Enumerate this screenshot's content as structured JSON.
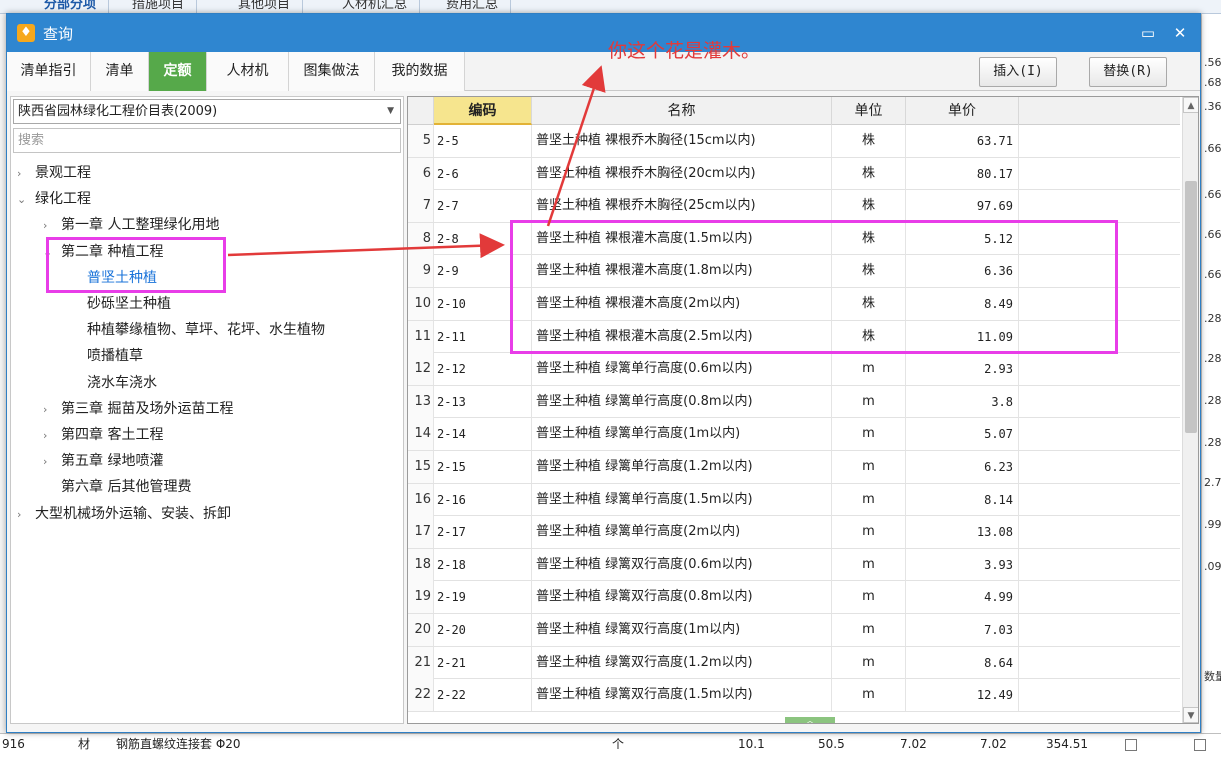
{
  "background": {
    "top_tabs": [
      "分部分项",
      "措施项目",
      "其他项目",
      "人材机汇总",
      "费用汇总"
    ],
    "right_numbers": [
      ".56",
      ".68",
      ".36",
      ".66",
      ".66",
      ".66",
      ".66",
      ".28",
      ".28",
      ".28",
      ".28",
      "2.7",
      ".99",
      ".09",
      "数量"
    ],
    "bottom_row": {
      "code": "916",
      "type": "材",
      "name": "钢筋直螺纹连接套 Φ20",
      "unit": "个",
      "v1": "10.1",
      "v2": "50.5",
      "v3": "7.02",
      "v4": "7.02",
      "v5": "354.51"
    }
  },
  "dialog": {
    "title": "查询",
    "title_icon": "bell-icon",
    "minimize_glyph": "▭",
    "close_glyph": "✕",
    "tabs": [
      "清单指引",
      "清单",
      "定额",
      "人材机",
      "图集做法",
      "我的数据"
    ],
    "active_tab": "定额",
    "insert_label": "插入(I)",
    "replace_label": "替换(R)"
  },
  "left": {
    "library": "陕西省园林绿化工程价目表(2009)",
    "search_placeholder": "搜索",
    "tree": [
      {
        "label": "景观工程",
        "level": 0,
        "arrow": "›"
      },
      {
        "label": "绿化工程",
        "level": 0,
        "arrow": "⌄"
      },
      {
        "label": "第一章 人工整理绿化用地",
        "level": 1,
        "arrow": "›"
      },
      {
        "label": "第二章 种植工程",
        "level": 1,
        "arrow": "⌄"
      },
      {
        "label": "普坚土种植",
        "level": 2,
        "arrow": ""
      },
      {
        "label": "砂砾坚土种植",
        "level": 2,
        "arrow": ""
      },
      {
        "label": "种植攀缘植物、草坪、花坪、水生植物",
        "level": 2,
        "arrow": ""
      },
      {
        "label": "喷播植草",
        "level": 2,
        "arrow": ""
      },
      {
        "label": "浇水车浇水",
        "level": 2,
        "arrow": ""
      },
      {
        "label": "第三章 掘苗及场外运苗工程",
        "level": 1,
        "arrow": "›"
      },
      {
        "label": "第四章 客土工程",
        "level": 1,
        "arrow": "›"
      },
      {
        "label": "第五章 绿地喷灌",
        "level": 1,
        "arrow": "›"
      },
      {
        "label": "第六章 后其他管理费",
        "level": 1,
        "arrow": ""
      },
      {
        "label": "大型机械场外运输、安装、拆卸",
        "level": 0,
        "arrow": "›"
      }
    ],
    "selected": "普坚土种植"
  },
  "grid": {
    "headers": {
      "code": "编码",
      "name": "名称",
      "unit": "单位",
      "price": "单价"
    },
    "rows": [
      {
        "idx": "5",
        "code": "2-5",
        "name": "普坚土种植 裸根乔木胸径(15cm以内)",
        "unit": "株",
        "price": "63.71"
      },
      {
        "idx": "6",
        "code": "2-6",
        "name": "普坚土种植 裸根乔木胸径(20cm以内)",
        "unit": "株",
        "price": "80.17"
      },
      {
        "idx": "7",
        "code": "2-7",
        "name": "普坚土种植 裸根乔木胸径(25cm以内)",
        "unit": "株",
        "price": "97.69"
      },
      {
        "idx": "8",
        "code": "2-8",
        "name": "普坚土种植 裸根灌木高度(1.5m以内)",
        "unit": "株",
        "price": "5.12"
      },
      {
        "idx": "9",
        "code": "2-9",
        "name": "普坚土种植 裸根灌木高度(1.8m以内)",
        "unit": "株",
        "price": "6.36"
      },
      {
        "idx": "10",
        "code": "2-10",
        "name": "普坚土种植 裸根灌木高度(2m以内)",
        "unit": "株",
        "price": "8.49"
      },
      {
        "idx": "11",
        "code": "2-11",
        "name": "普坚土种植 裸根灌木高度(2.5m以内)",
        "unit": "株",
        "price": "11.09"
      },
      {
        "idx": "12",
        "code": "2-12",
        "name": "普坚土种植 绿篱单行高度(0.6m以内)",
        "unit": "m",
        "price": "2.93"
      },
      {
        "idx": "13",
        "code": "2-13",
        "name": "普坚土种植 绿篱单行高度(0.8m以内)",
        "unit": "m",
        "price": "3.8"
      },
      {
        "idx": "14",
        "code": "2-14",
        "name": "普坚土种植 绿篱单行高度(1m以内)",
        "unit": "m",
        "price": "5.07"
      },
      {
        "idx": "15",
        "code": "2-15",
        "name": "普坚土种植 绿篱单行高度(1.2m以内)",
        "unit": "m",
        "price": "6.23"
      },
      {
        "idx": "16",
        "code": "2-16",
        "name": "普坚土种植 绿篱单行高度(1.5m以内)",
        "unit": "m",
        "price": "8.14"
      },
      {
        "idx": "17",
        "code": "2-17",
        "name": "普坚土种植 绿篱单行高度(2m以内)",
        "unit": "m",
        "price": "13.08"
      },
      {
        "idx": "18",
        "code": "2-18",
        "name": "普坚土种植 绿篱双行高度(0.6m以内)",
        "unit": "m",
        "price": "3.93"
      },
      {
        "idx": "19",
        "code": "2-19",
        "name": "普坚土种植 绿篱双行高度(0.8m以内)",
        "unit": "m",
        "price": "4.99"
      },
      {
        "idx": "20",
        "code": "2-20",
        "name": "普坚土种植 绿篱双行高度(1m以内)",
        "unit": "m",
        "price": "7.03"
      },
      {
        "idx": "21",
        "code": "2-21",
        "name": "普坚土种植 绿篱双行高度(1.2m以内)",
        "unit": "m",
        "price": "8.64"
      },
      {
        "idx": "22",
        "code": "2-22",
        "name": "普坚土种植 绿篱双行高度(1.5m以内)",
        "unit": "m",
        "price": "12.49"
      }
    ]
  },
  "annotation": {
    "text": "你这个花是灌木。",
    "color": "#e23a3a",
    "box_color": "#e83de8"
  }
}
